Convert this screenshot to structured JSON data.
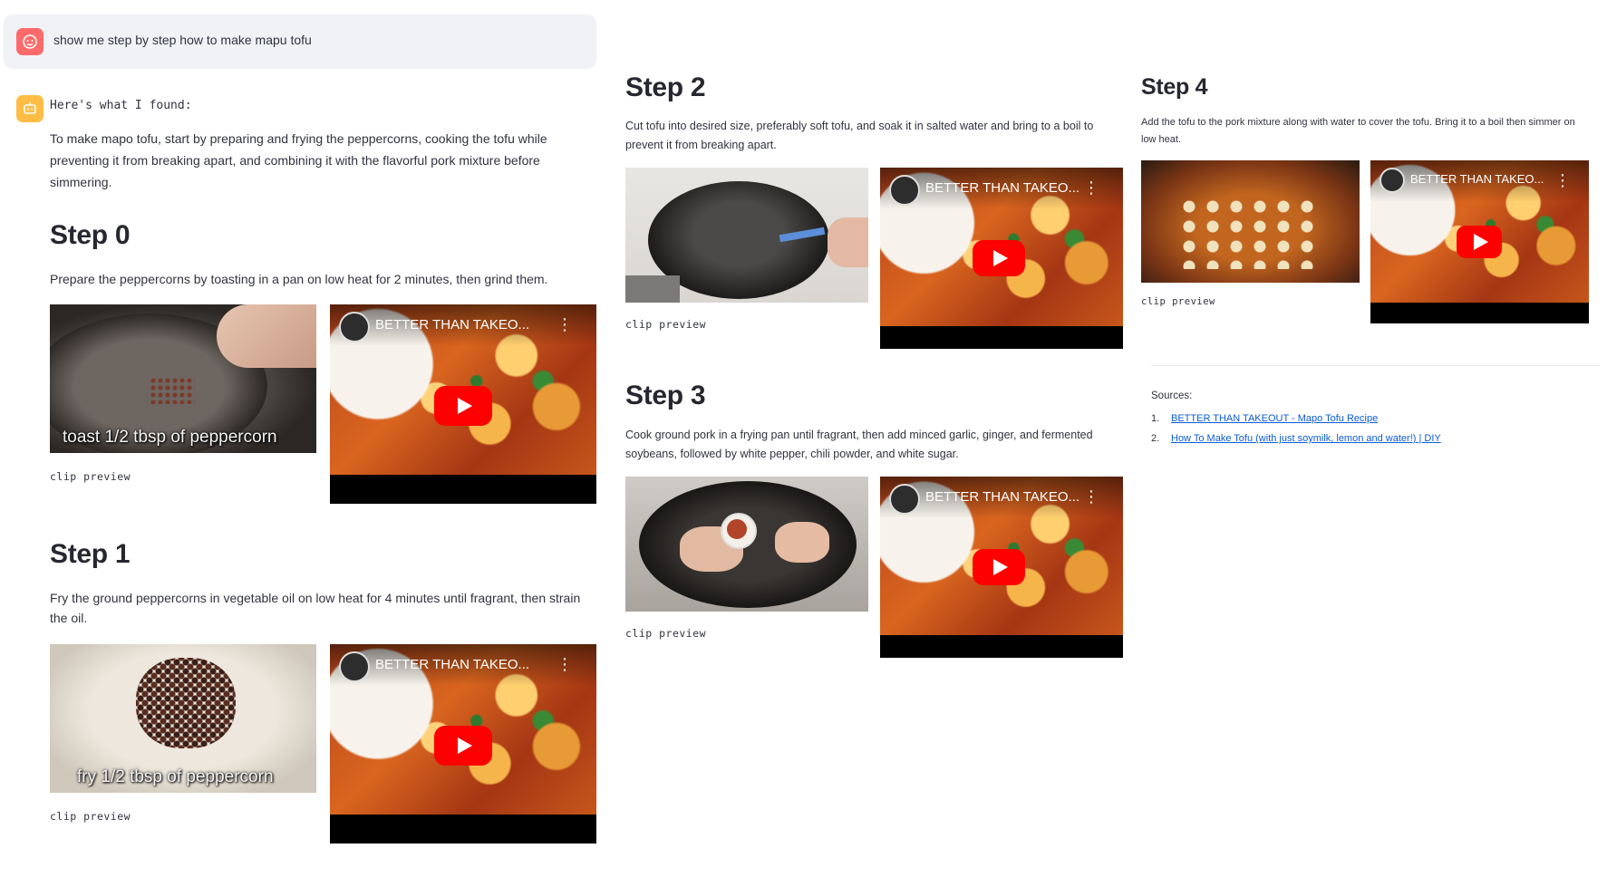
{
  "chat": {
    "user_message": "show me step by step how to make mapu tofu",
    "bot_intro": "Here's what I found:",
    "summary": "To make mapo tofu, start by preparing and frying the peppercorns, cooking the tofu while preventing it from breaking apart, and combining it with the flavorful pork mixture before simmering."
  },
  "steps": [
    {
      "title": "Step 0",
      "description": "Prepare the peppercorns by toasting in a pan on low heat for 2 minutes, then grind them.",
      "clip_overlay": "toast 1/2 tbsp of peppercorn",
      "clip_caption": "clip preview",
      "video_title": "BETTER THAN TAKEO..."
    },
    {
      "title": "Step 1",
      "description": "Fry the ground peppercorns in vegetable oil on low heat for 4 minutes until fragrant, then strain the oil.",
      "clip_overlay": "fry 1/2 tbsp of peppercorn",
      "clip_caption": "clip preview",
      "video_title": "BETTER THAN TAKEO..."
    },
    {
      "title": "Step 2",
      "description": "Cut tofu into desired size, preferably soft tofu, and soak it in salted water and bring to a boil to prevent it from breaking apart.",
      "clip_caption": "clip preview",
      "video_title": "BETTER THAN TAKEO..."
    },
    {
      "title": "Step 3",
      "description": "Cook ground pork in a frying pan until fragrant, then add minced garlic, ginger, and fermented soybeans, followed by white pepper, chili powder, and white sugar.",
      "clip_caption": "clip preview",
      "video_title": "BETTER THAN TAKEO..."
    },
    {
      "title": "Step 4",
      "description": "Add the tofu to the pork mixture along with water to cover the tofu. Bring it to a boil then simmer on low heat.",
      "clip_caption": "clip preview",
      "video_title": "BETTER THAN TAKEO..."
    }
  ],
  "sources": {
    "label": "Sources:",
    "items": [
      {
        "num": "1.",
        "text": "BETTER THAN TAKEOUT - Mapo Tofu Recipe"
      },
      {
        "num": "2.",
        "text": "How To Make Tofu (with just soymilk, lemon and water!) | DIY"
      }
    ]
  },
  "colors": {
    "user_avatar": "#ff6b6b",
    "bot_avatar": "#ffbd45",
    "link": "#0b5cd5",
    "youtube_red": "#ff0000"
  },
  "icons": {
    "user_avatar": "face-icon",
    "bot_avatar": "robot-icon",
    "play": "play-icon",
    "more": "more-vertical-icon"
  }
}
